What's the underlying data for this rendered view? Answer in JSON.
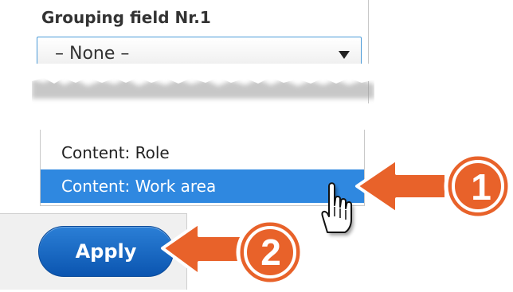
{
  "grouping": {
    "label": "Grouping field Nr.1",
    "selected_value": "– None –"
  },
  "dropdown": {
    "options": [
      "Content: Role",
      "Content: Work area"
    ],
    "highlighted_index": 1
  },
  "actions": {
    "apply_label": "Apply"
  },
  "callouts": [
    {
      "number": "1",
      "points_to": "Content: Work area"
    },
    {
      "number": "2",
      "points_to": "Apply"
    }
  ],
  "colors": {
    "highlight": "#2f88e0",
    "apply_button": "#1565c0",
    "callout": "#e8622a"
  },
  "icons": {
    "select_arrow": "triangle-down-icon",
    "cursor": "hand-pointer-icon"
  }
}
